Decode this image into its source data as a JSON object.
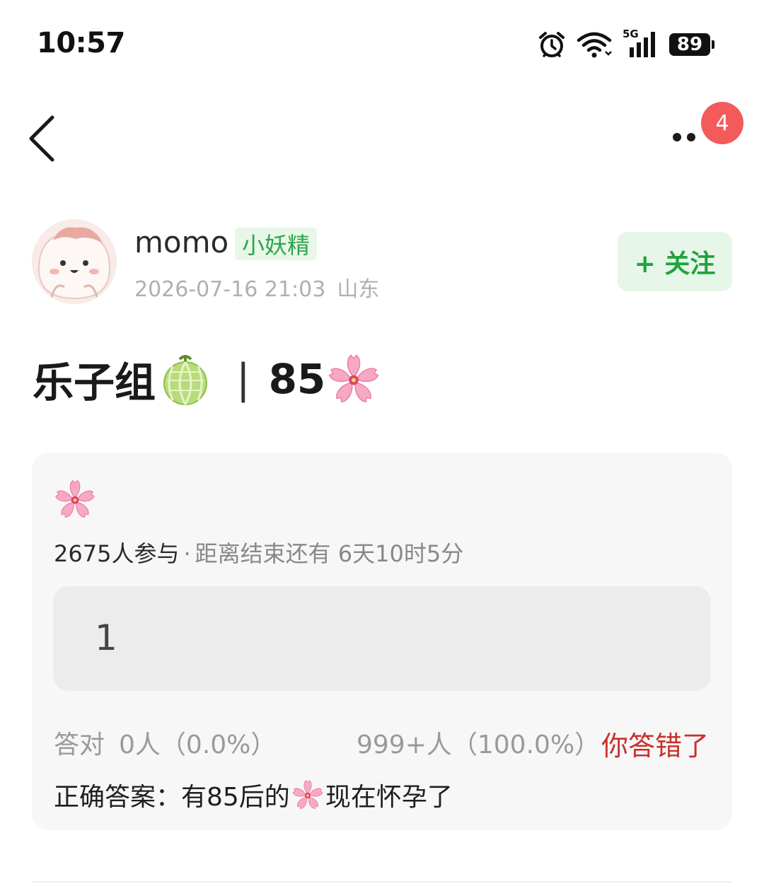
{
  "status_bar": {
    "time": "10:57",
    "network": "5G",
    "battery": "89",
    "icons": [
      "alarm-icon",
      "wifi-icon",
      "signal-icon",
      "battery-icon"
    ]
  },
  "nav": {
    "back_icon": "chevron-left-icon",
    "more_icon": "more-dots-icon",
    "notification_count": "4"
  },
  "post": {
    "author": {
      "name": "momo",
      "tag": "小妖精",
      "datetime": "2026-07-16 21:03",
      "location": "山东"
    },
    "follow_label": "+ 关注",
    "title": {
      "text_before": "乐子组",
      "separator": "|",
      "text_after": "85"
    }
  },
  "quiz": {
    "participants": "2675人参与",
    "dot": "·",
    "time_remaining": "距离结束还有 6天10时5分",
    "option_label": "1",
    "correct_label": "答对",
    "correct_stat": "0人（0.0%）",
    "wrong_stat": "999+人（100.0%）",
    "result": "你答错了",
    "answer_prefix": "正确答案：有85后的",
    "answer_suffix": "现在怀孕了"
  },
  "colors": {
    "accent_green": "#22a23c",
    "badge_red": "#f35b5b",
    "wrong_red": "#c9302c",
    "card_bg": "#f7f7f7"
  }
}
